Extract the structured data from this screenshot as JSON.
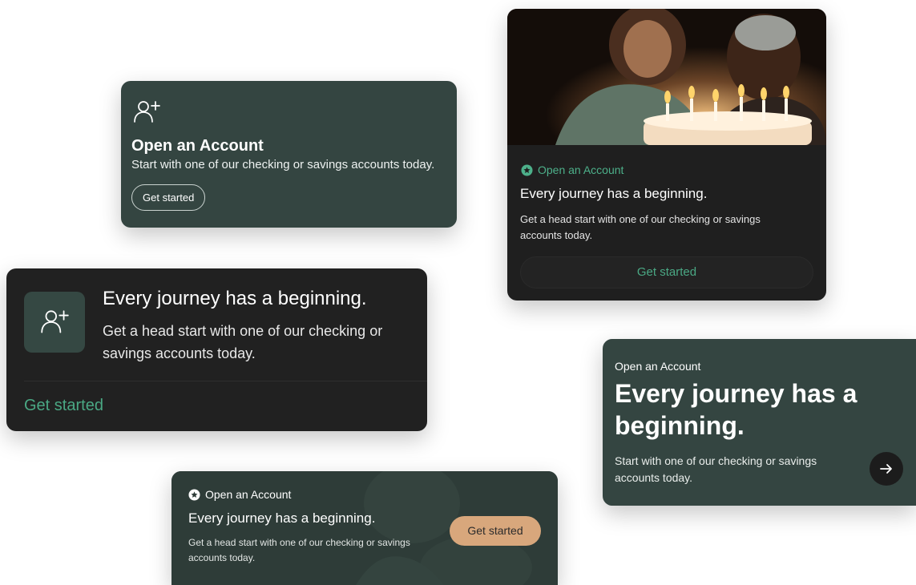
{
  "colors": {
    "dark_green": "#344541",
    "charcoal": "#1f1f1f",
    "accent_green": "#4aa884",
    "tan": "#d8a77c"
  },
  "card_compact": {
    "icon": "add-user-icon",
    "title": "Open an Account",
    "subtitle": "Start with one of our checking or savings accounts today.",
    "button": "Get started"
  },
  "card_photo": {
    "image": "birthday-cake-photo",
    "eyebrow_icon": "star-badge-icon",
    "eyebrow": "Open an Account",
    "headline": "Every journey has a beginning.",
    "body": "Get a head start with one of our checking or savings accounts today.",
    "button": "Get started"
  },
  "card_icon_tile": {
    "icon": "add-user-icon",
    "headline": "Every journey has a beginning.",
    "body": "Get a head start with one of our checking or savings accounts today.",
    "button": "Get started"
  },
  "card_hero": {
    "eyebrow": "Open an Account",
    "headline": "Every journey has a beginning.",
    "body": "Start with one of our checking or savings accounts today.",
    "arrow_icon": "arrow-right-icon"
  },
  "card_banner": {
    "eyebrow_icon": "star-badge-icon",
    "eyebrow": "Open an Account",
    "headline": "Every journey has a beginning.",
    "body": "Get a head start with one of our checking or savings accounts today.",
    "button": "Get started"
  }
}
